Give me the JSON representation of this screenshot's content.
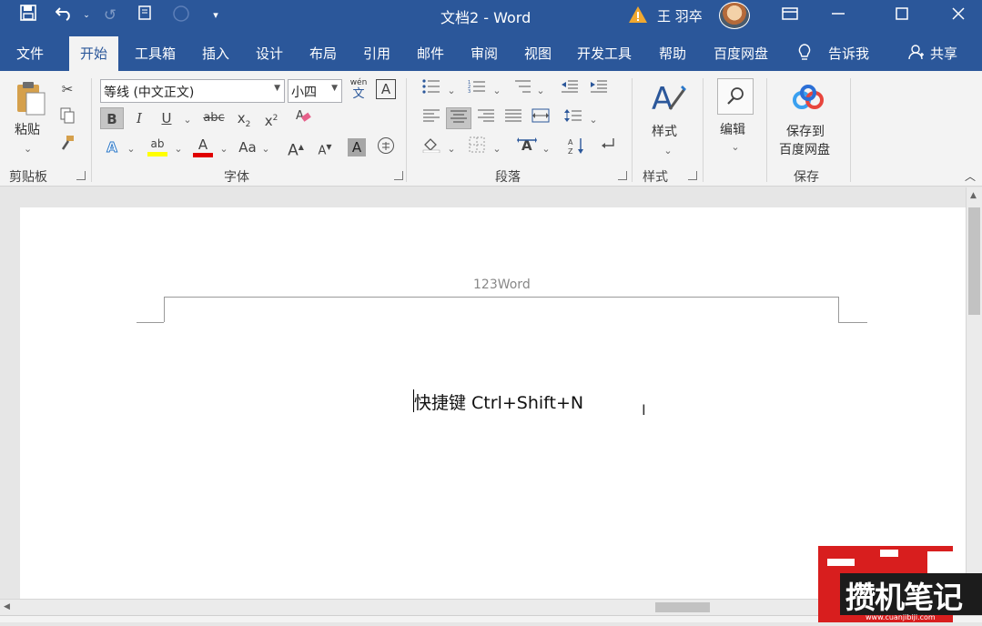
{
  "titlebar": {
    "doc_title": "文档2  -  Word",
    "user_name": "王 羽卒"
  },
  "tabs": [
    {
      "label": "文件"
    },
    {
      "label": "开始"
    },
    {
      "label": "工具箱"
    },
    {
      "label": "插入"
    },
    {
      "label": "设计"
    },
    {
      "label": "布局"
    },
    {
      "label": "引用"
    },
    {
      "label": "邮件"
    },
    {
      "label": "审阅"
    },
    {
      "label": "视图"
    },
    {
      "label": "开发工具"
    },
    {
      "label": "帮助"
    },
    {
      "label": "百度网盘"
    }
  ],
  "tell_me": "告诉我",
  "share": "共享",
  "ribbon": {
    "clipboard": {
      "paste_label": "粘贴",
      "group_label": "剪贴板"
    },
    "font": {
      "font_name": "等线 (中文正文)",
      "font_size": "小四",
      "group_label": "字体",
      "phonetic_top": "wén",
      "phonetic_bottom": "文",
      "char_border": "A",
      "bold": "B",
      "italic": "I",
      "underline": "U",
      "strike": "abc",
      "subscript": "x",
      "sub_mark": "2",
      "superscript": "x",
      "sup_mark": "2",
      "text_effect": "A",
      "font_color": "A",
      "change_case": "Aa",
      "grow": "A",
      "shrink": "A",
      "shading": "A",
      "enclose": "字",
      "highlight": "ab"
    },
    "paragraph": {
      "group_label": "段落"
    },
    "styles": {
      "label": "样式",
      "group_label": "样式"
    },
    "editing": {
      "label": "编辑"
    },
    "save": {
      "label_line1": "保存到",
      "label_line2": "百度网盘",
      "group_label": "保存"
    }
  },
  "document": {
    "header_text": "123Word",
    "body_text": "快捷键 Ctrl+Shift+N"
  },
  "watermark": {
    "logo_text": "攒机笔记",
    "url": "www.cuanjibiji.com"
  },
  "colors": {
    "accent": "#2b579a",
    "highlight": "#ffff00",
    "font_red": "#e00000",
    "logo_red": "#d81e1e"
  }
}
